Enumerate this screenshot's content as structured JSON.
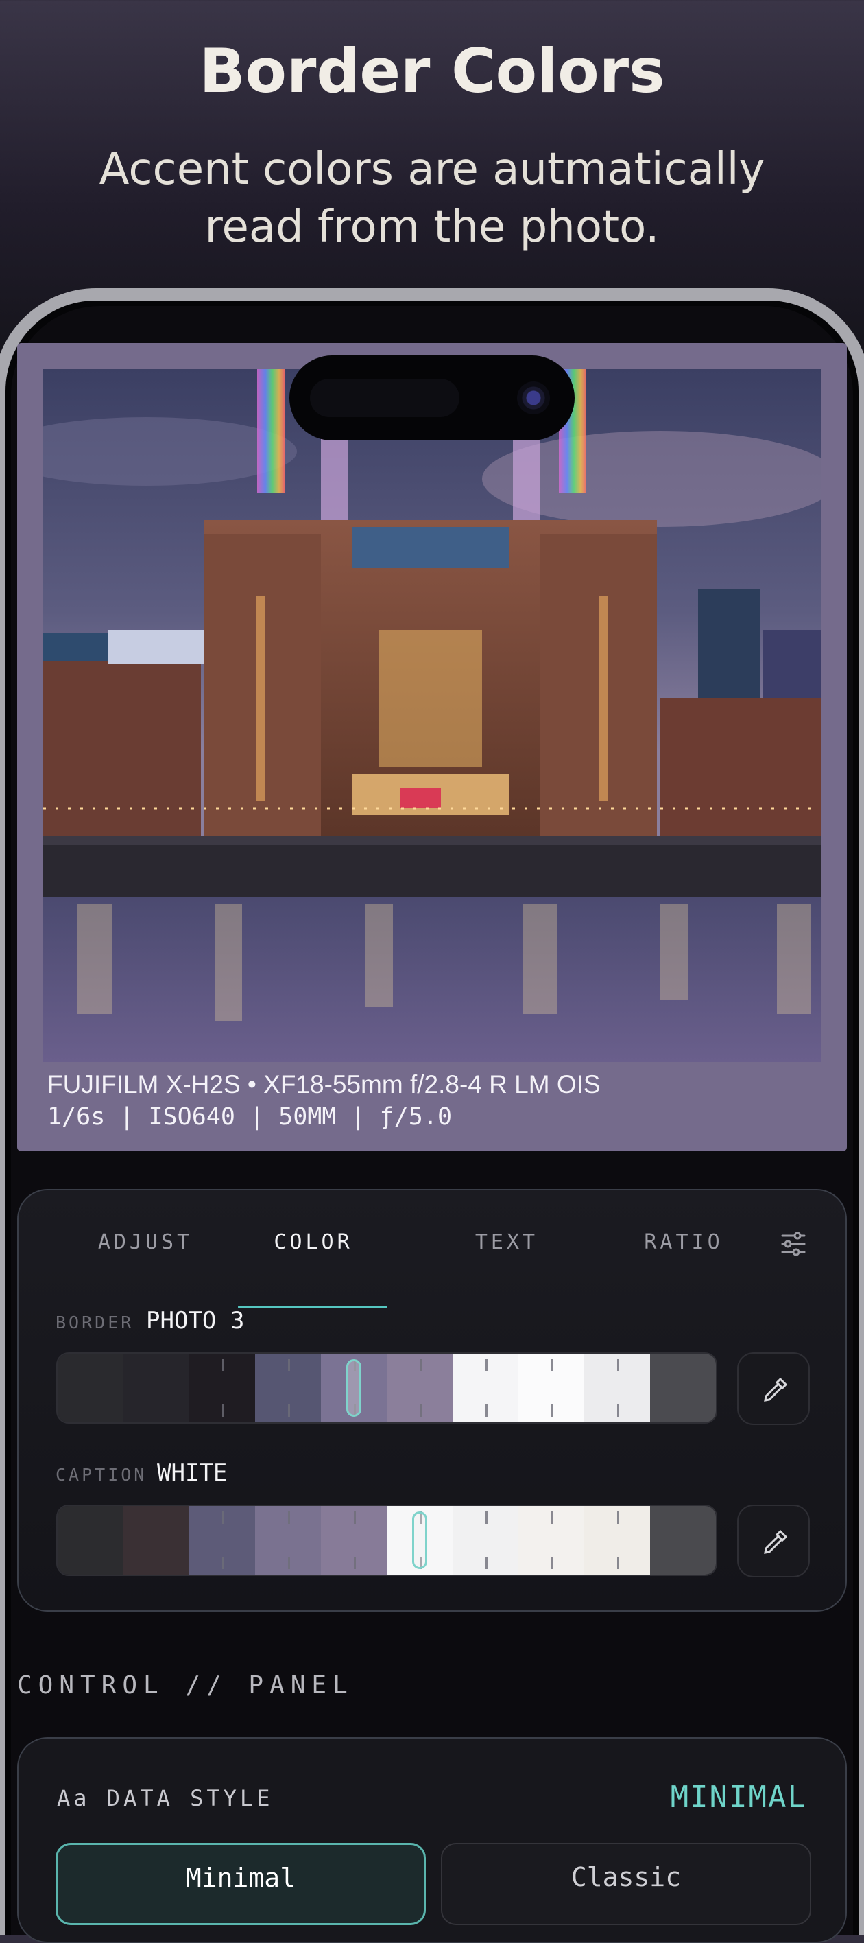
{
  "header": {
    "title": "Border Colors",
    "subtitle_line1": "Accent colors are autmatically",
    "subtitle_line2": "read from the photo."
  },
  "photo_card": {
    "border_color": "#756b8c",
    "caption_line1": "FUJIFILM X-H2S • XF18-55mm f/2.8-4 R LM OIS",
    "caption_line2": "1/6s | ISO640 | 50MM | ƒ/5.0"
  },
  "color_panel": {
    "tabs": [
      {
        "label": "ADJUST",
        "active": false
      },
      {
        "label": "COLOR",
        "active": true
      },
      {
        "label": "TEXT",
        "active": false
      },
      {
        "label": "RATIO",
        "active": false
      }
    ],
    "accent": "#55c6c0",
    "settings_icon": "sliders-icon",
    "border": {
      "label": "BORDER",
      "value": "PHOTO 3",
      "swatches": [
        "#2a2a2e",
        "#26252b",
        "#1f1c22",
        "#565672",
        "#7b7394",
        "#8b7f9b",
        "#f5f5f7",
        "#fbfbfc",
        "#ececee",
        "#4b4b50"
      ],
      "selected_index": 4,
      "picker_icon": "eyedropper-icon"
    },
    "caption": {
      "label": "CAPTION",
      "value": "WHITE",
      "swatches": [
        "#2c2c2f",
        "#3a3034",
        "#5d5b78",
        "#7a7290",
        "#877b98",
        "#f7f7f8",
        "#f1f1f2",
        "#f3f1ee",
        "#f0ede8",
        "#4a4a4e"
      ],
      "selected_index": 5,
      "picker_icon": "eyedropper-icon"
    }
  },
  "control_panel": {
    "section_title": "CONTROL // PANEL",
    "data_style_label": "Aa DATA STYLE",
    "data_style_value": "MINIMAL",
    "options": [
      "Minimal",
      "Classic"
    ]
  }
}
